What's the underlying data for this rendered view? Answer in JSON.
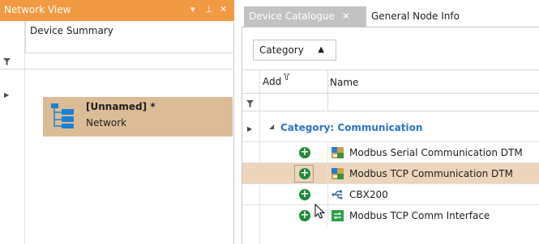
{
  "network_view": {
    "title": "Network View",
    "pin_glyph": "▾ ⊥ ✕",
    "column_header": "Device Summary",
    "node": {
      "name": "[Unnamed]",
      "modified_marker": "*",
      "type": "Network"
    }
  },
  "tabs": [
    {
      "label": "Device Catalogue",
      "close": "✕"
    },
    {
      "label": "General Node Info"
    }
  ],
  "catalogue": {
    "sort_button": {
      "label": "Category",
      "arrow": "▲"
    },
    "columns": {
      "add": "Add",
      "name": "Name"
    },
    "group": {
      "label": "Category: Communication"
    },
    "items": [
      {
        "name": "Modbus Serial Communication DTM",
        "icon": "dtm-icon",
        "selected": false
      },
      {
        "name": "Modbus TCP Communication DTM",
        "icon": "dtm-icon",
        "selected": true
      },
      {
        "name": "CBX200",
        "icon": "usb-icon",
        "selected": false
      },
      {
        "name": "Modbus TCP Comm Interface",
        "icon": "comm-interface-icon",
        "selected": false
      }
    ]
  },
  "colors": {
    "accent_orange": "#f29a43",
    "selection": "#dcbc97",
    "group_blue": "#2b74c7",
    "add_green": "#1f8a3a"
  }
}
